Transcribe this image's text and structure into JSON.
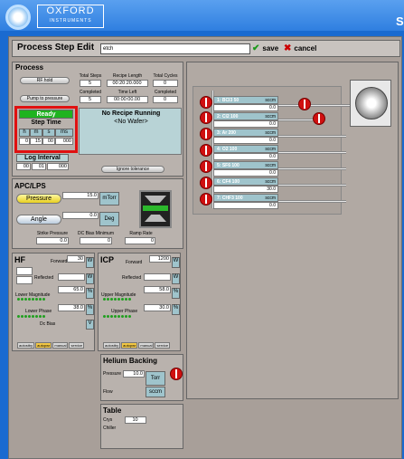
{
  "header": {
    "logo_line1": "OXFORD",
    "logo_line2": "INSTRUMENTS",
    "corner_letter": "S"
  },
  "title": {
    "text": "Process Step Edit",
    "name_value": "etch",
    "save": "save",
    "cancel": "cancel"
  },
  "process": {
    "title": "Process",
    "rf_hold": "RF hold",
    "pump_to_pressure": "Pump to pressure",
    "total_steps_label": "Total Steps",
    "total_steps": "5",
    "recipe_length_label": "Recipe Length",
    "recipe_length": "00:20:20.000",
    "total_cycles_label": "Total Cycles",
    "total_cycles": "0",
    "completed_label": "Completed",
    "completed_steps": "5",
    "time_left_label": "Time Left",
    "time_left": "00:00:00.00",
    "completed_label2": "Completed",
    "completed_cycles": "0",
    "status": "Ready",
    "step_time": "Step Time",
    "h": "h",
    "m": "m",
    "s": "s",
    "ms": "ms",
    "h_val": "0",
    "m_val": "15",
    "s_val": "00",
    "ms_val": "000",
    "log_interval": "Log Interval",
    "log_h": "00",
    "log_m": "01",
    "log_s": "000",
    "no_recipe": "No Recipe Running",
    "no_wafer": "<No Wafer>",
    "ignore_tolerance": "Ignore tolerance"
  },
  "apc": {
    "title": "APC/LPS",
    "pressure_btn": "Pressure",
    "pressure_val": "15.0",
    "pressure_unit": "mTorr",
    "angle_btn": "Angle",
    "angle_val": "0.0",
    "angle_unit": "Deg",
    "strike_label": "Strike Pressure",
    "strike_val": "0.0",
    "dc_bias_label": "DC Bias Minimum",
    "dc_bias_val": "0",
    "ramp_label": "Ramp Rate",
    "ramp_val": "0"
  },
  "hf": {
    "title": "HF",
    "forward": "Forward",
    "forward_val": "30",
    "reflected": "Reflected",
    "w": "W",
    "lower_mag": "Lower Magnitude",
    "lower_mag_val": "65.0",
    "lower_phase": "Lower Phase",
    "lower_phase_val": "38.0",
    "pct": "%",
    "dc_bias": "Dc Bias",
    "v": "V",
    "tabs": [
      "autostby",
      "autopwr",
      "manual",
      "service"
    ]
  },
  "icp": {
    "title": "ICP",
    "forward": "Forward",
    "forward_val": "1200",
    "reflected": "Reflected",
    "w": "W",
    "upper_mag": "Upper Magnitude",
    "upper_mag_val": "58.0",
    "upper_phase": "Upper Phase",
    "upper_phase_val": "30.0",
    "pct": "%",
    "tabs": [
      "autostby",
      "autopwr",
      "manual",
      "service"
    ]
  },
  "helium": {
    "title": "Helium Backing",
    "pressure": "Pressure",
    "pressure_val": "10.0",
    "torr": "Torr",
    "flow": "Flow",
    "sccm": "sccm"
  },
  "table": {
    "title": "Table",
    "crys": "Crys",
    "crys_val": "10",
    "chiller": "Chiller"
  },
  "gases": [
    {
      "label": "1:  BCl3 50",
      "unit": "sccm",
      "value": "0.0"
    },
    {
      "label": "2:  Cl2 100",
      "unit": "sccm",
      "value": "0.0"
    },
    {
      "label": "3:  Ar 200",
      "unit": "sccm",
      "value": "0.0"
    },
    {
      "label": "4:  O2 100",
      "unit": "sccm",
      "value": "0.0"
    },
    {
      "label": "5:  SF6 100",
      "unit": "sccm",
      "value": "0.0"
    },
    {
      "label": "6:  CF4 100",
      "unit": "sccm",
      "value": "30.0"
    },
    {
      "label": "7:  CHF3 100",
      "unit": "sccm",
      "value": "0.0"
    }
  ]
}
